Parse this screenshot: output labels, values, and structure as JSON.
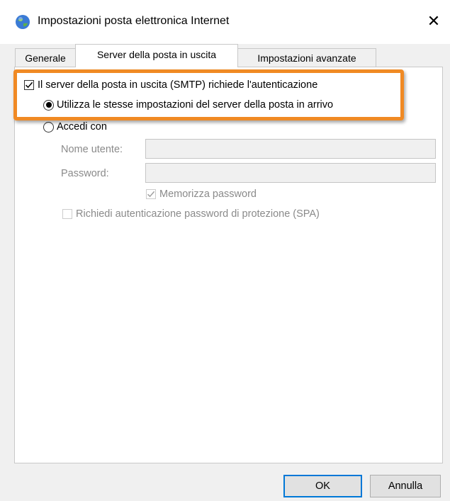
{
  "window": {
    "title": "Impostazioni posta elettronica Internet",
    "close_glyph": "✕"
  },
  "tabs": [
    {
      "label": "Generale",
      "active": false
    },
    {
      "label": "Server della posta in uscita",
      "active": true
    },
    {
      "label": "Impostazioni avanzate",
      "active": false
    }
  ],
  "outgoing": {
    "smtp_auth_label": "Il server della posta in uscita (SMTP) richiede l'autenticazione",
    "smtp_auth_checked": true,
    "use_same_label": "Utilizza le stesse impostazioni del server della posta in arrivo",
    "use_same_selected": true,
    "login_with_label": "Accedi con",
    "login_with_selected": false,
    "username_label": "Nome utente:",
    "username_value": "",
    "password_label": "Password:",
    "password_value": "",
    "remember_password_label": "Memorizza password",
    "remember_password_checked": true,
    "spa_label": "Richiedi autenticazione password di protezione (SPA)",
    "spa_checked": false
  },
  "buttons": {
    "ok": "OK",
    "cancel": "Annulla"
  },
  "colors": {
    "highlight": "#f08a24",
    "ok_border": "#0078d7"
  }
}
